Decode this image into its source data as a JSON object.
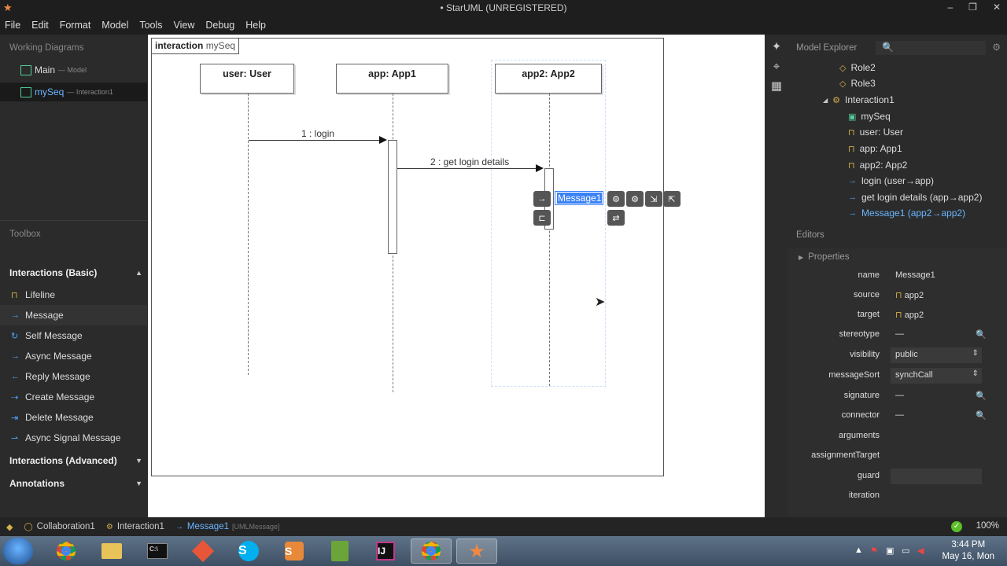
{
  "window": {
    "title": "• StarUML (UNREGISTERED)",
    "controls": [
      "–",
      "❐",
      "✕"
    ]
  },
  "menu": [
    "File",
    "Edit",
    "Format",
    "Model",
    "Tools",
    "View",
    "Debug",
    "Help"
  ],
  "working_diagrams": {
    "title": "Working Diagrams",
    "items": [
      {
        "name": "Main",
        "sub": "— Model"
      },
      {
        "name": "mySeq",
        "sub": "— Interaction1"
      }
    ]
  },
  "toolbox": {
    "title": "Toolbox",
    "group_basic": "Interactions (Basic)",
    "items": [
      "Lifeline",
      "Message",
      "Self Message",
      "Async Message",
      "Reply Message",
      "Create Message",
      "Delete Message",
      "Async Signal Message"
    ],
    "group_advanced": "Interactions (Advanced)",
    "group_annotations": "Annotations"
  },
  "diagram": {
    "frame_kind": "interaction",
    "frame_name": "mySeq",
    "lifelines": [
      "user: User",
      "app: App1",
      "app2: App2"
    ],
    "messages": [
      "1 : login",
      "2 : get login details"
    ],
    "editing_message": "Message1"
  },
  "model_explorer": {
    "title": "Model Explorer",
    "search_icon": "🔍",
    "items": [
      "Role2",
      "Role3",
      "Interaction1",
      "mySeq",
      "user: User",
      "app: App1",
      "app2: App2",
      "login (user→app)",
      "get login details (app→app2)",
      "Message1 (app2→app2)"
    ]
  },
  "editors": {
    "title": "Editors",
    "properties_title": "Properties",
    "rows": [
      {
        "label": "name",
        "value": "Message1"
      },
      {
        "label": "source",
        "value": "app2"
      },
      {
        "label": "target",
        "value": "app2"
      },
      {
        "label": "stereotype",
        "value": "—"
      },
      {
        "label": "visibility",
        "value": "public"
      },
      {
        "label": "messageSort",
        "value": "synchCall"
      },
      {
        "label": "signature",
        "value": "—"
      },
      {
        "label": "connector",
        "value": "—"
      },
      {
        "label": "arguments",
        "value": ""
      },
      {
        "label": "assignmentTarget",
        "value": ""
      },
      {
        "label": "guard",
        "value": ""
      },
      {
        "label": "iteration",
        "value": ""
      }
    ]
  },
  "status": {
    "crumbs": [
      "Collaboration1",
      "Interaction1",
      "Message1"
    ],
    "selected_type": "[UMLMessage]",
    "zoom": "100%"
  },
  "taskbar": {
    "time": "3:44 PM",
    "date": "May 16, Mon"
  },
  "colors": {
    "accent": "#3b82f6",
    "tree_selected": "#6bb5ff",
    "lifeline_icon": "#d5b04a",
    "ok_status": "#5cbf2a"
  }
}
